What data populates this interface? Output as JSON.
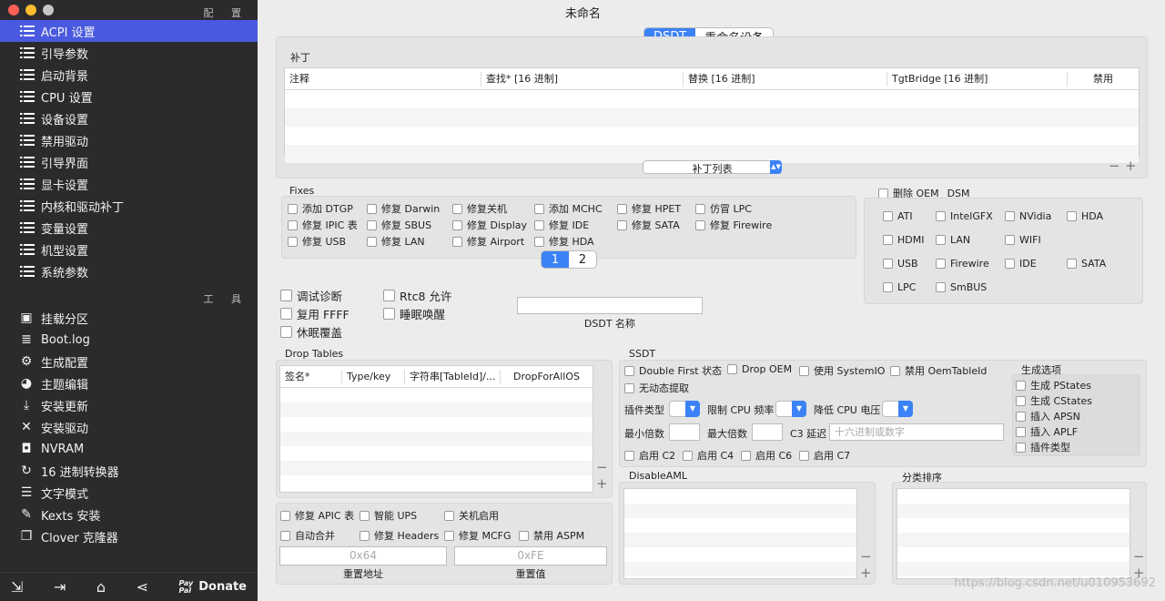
{
  "window_title": "未命名",
  "sidebar": {
    "config_title": "配 置",
    "items": [
      {
        "label": "ACPI 设置",
        "active": true
      },
      {
        "label": "引导参数"
      },
      {
        "label": "启动背景"
      },
      {
        "label": "CPU 设置"
      },
      {
        "label": "设备设置"
      },
      {
        "label": "禁用驱动"
      },
      {
        "label": "引导界面"
      },
      {
        "label": "显卡设置"
      },
      {
        "label": "内核和驱动补丁"
      },
      {
        "label": "变量设置"
      },
      {
        "label": "机型设置"
      },
      {
        "label": "系统参数"
      }
    ],
    "tools_title": "工 具",
    "tools": [
      {
        "label": "挂载分区",
        "icon": "disk-icon"
      },
      {
        "label": "Boot.log",
        "icon": "log-icon"
      },
      {
        "label": "生成配置",
        "icon": "gear-icon"
      },
      {
        "label": "主题编辑",
        "icon": "palette-icon"
      },
      {
        "label": "安装更新",
        "icon": "download-icon"
      },
      {
        "label": "安装驱动",
        "icon": "wrench-icon"
      },
      {
        "label": "NVRAM",
        "icon": "chip-icon"
      },
      {
        "label": "16 进制转换器",
        "icon": "refresh-icon"
      },
      {
        "label": "文字模式",
        "icon": "text-icon"
      },
      {
        "label": "Kexts 安装",
        "icon": "brush-icon"
      },
      {
        "label": "Clover 克隆器",
        "icon": "copy-icon"
      }
    ],
    "bottom": {
      "donate_label": "Donate",
      "paypal_pay": "Pay",
      "paypal_pal": "Pal"
    }
  },
  "tabs": [
    {
      "label": "DSDT",
      "active": true
    },
    {
      "label": "重命名设备"
    }
  ],
  "patches": {
    "title": "补丁",
    "columns": [
      "注释",
      "查找* [16 进制]",
      "替换 [16 进制]",
      "TgtBridge [16 进制]",
      "禁用"
    ],
    "list_popup": "补丁列表"
  },
  "fixes": {
    "title": "Fixes",
    "row1": [
      "添加 DTGP",
      "修复 Darwin",
      "修复关机",
      "添加 MCHC",
      "修复 HPET",
      "仿冒 LPC"
    ],
    "row2": [
      "修复 IPIC 表",
      "修复 SBUS",
      "修复 Display",
      "修复 IDE",
      "修复 SATA",
      "修复 Firewire"
    ],
    "row3": [
      "修复 USB",
      "修复 LAN",
      "修复 Airport",
      "修复 HDA"
    ],
    "pages": [
      "1",
      "2"
    ]
  },
  "remove_oem_dsm": {
    "title": "删除 OEM _DSM",
    "row1": [
      "ATI",
      "IntelGFX",
      "NVidia",
      "HDA"
    ],
    "row2": [
      "HDMI",
      "LAN",
      "WIFI"
    ],
    "row3": [
      "USB",
      "Firewire",
      "IDE",
      "SATA"
    ],
    "row4": [
      "LPC",
      "SmBUS"
    ]
  },
  "debug": {
    "c1": [
      "调试诊断",
      "复用 FFFF",
      "休眠覆盖"
    ],
    "c2": [
      "Rtc8 允许",
      "睡眠唤醒"
    ]
  },
  "dsdt_name_label": "DSDT 名称",
  "drop_tables": {
    "title": "Drop Tables",
    "columns": [
      "签名*",
      "Type/key",
      "字符串[TableId]/...",
      "DropForAllOS"
    ]
  },
  "ssdt": {
    "title": "SSDT",
    "row1": [
      "Double First 状态",
      "Drop OEM",
      "使用 SystemIO",
      "禁用 OemTableId"
    ],
    "row2": [
      "无动态提取"
    ],
    "plugin_type": "插件类型",
    "cpu_freq": "限制 CPU 频率",
    "cpu_volt": "降低 CPU 电压",
    "min_mult": "最小倍数",
    "max_mult": "最大倍数",
    "c3_delay": "C3 延迟",
    "c3_placeholder": "十六进制或数字",
    "c_states": [
      "启用 C2",
      "启用 C4",
      "启用 C6",
      "启用 C7"
    ],
    "gen_title": "生成选项",
    "gen": [
      "生成 PStates",
      "生成 CStates",
      "插入 APSN",
      "插入 APLF",
      "插件类型"
    ]
  },
  "misc": {
    "row1": [
      "修复 APIC 表",
      "智能 UPS",
      "关机启用"
    ],
    "row2": [
      "自动合并",
      "修复 Headers",
      "修复 MCFG",
      "禁用 ASPM"
    ],
    "reset_addr": "0x64",
    "reset_val": "0xFE",
    "reset_addr_label": "重置地址",
    "reset_val_label": "重置值"
  },
  "disable_aml_title": "DisableAML",
  "sort_order_title": "分类排序",
  "watermark": "https://blog.csdn.net/u010953692",
  "colors": {
    "accent": "#3b82f6",
    "sidebar_active": "#4a5ae0",
    "sidebar_bg": "#2b2b2d"
  }
}
